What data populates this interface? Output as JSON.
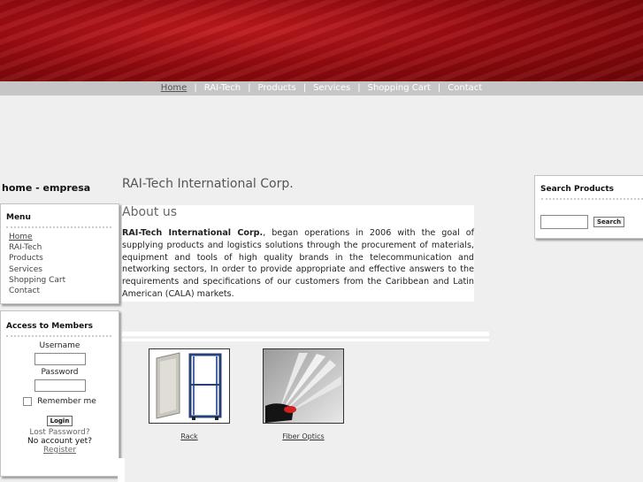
{
  "colors": {
    "banner": "#a51015",
    "navbar": "#c6c6c6",
    "page_bg": "#efefef"
  },
  "nav": [
    {
      "label": "Home",
      "active": true
    },
    {
      "label": "RAI-Tech"
    },
    {
      "label": "Products"
    },
    {
      "label": "Services"
    },
    {
      "label": "Shopping Cart"
    },
    {
      "label": "Contact"
    }
  ],
  "nav_separator": "|",
  "site_title": "home - empresa",
  "menu": {
    "title": "Menu",
    "items": [
      "Home",
      "RAI-Tech",
      "Products",
      "Services",
      "Shopping Cart",
      "Contact"
    ]
  },
  "login": {
    "title": "Access to Members",
    "username_label": "Username",
    "password_label": "Password",
    "remember_label": "Remember me",
    "login_button": "Login",
    "lost_password": "Lost Password?",
    "no_account": "No account yet?",
    "register": "Register"
  },
  "main": {
    "heading": "RAI-Tech International Corp.",
    "about_title": "About us",
    "about_company": "RAI-Tech International Corp.",
    "about_text": ", began operations in 2006 with the goal of supplying products and logistics solutions through the procurement of materials, equipment and tools of high quality brands in the telecommunication and networking sectors, In order to provide appropriate and effective answers to the requirements and specifications of our customers from the Caribbean and Latin American (CALA) markets."
  },
  "products": [
    {
      "label": "Rack",
      "icon": "rack-image"
    },
    {
      "label": "Fiber Optics",
      "icon": "fiber-optics-image"
    }
  ],
  "search": {
    "title": "Search Products",
    "button": "Search",
    "value": ""
  }
}
